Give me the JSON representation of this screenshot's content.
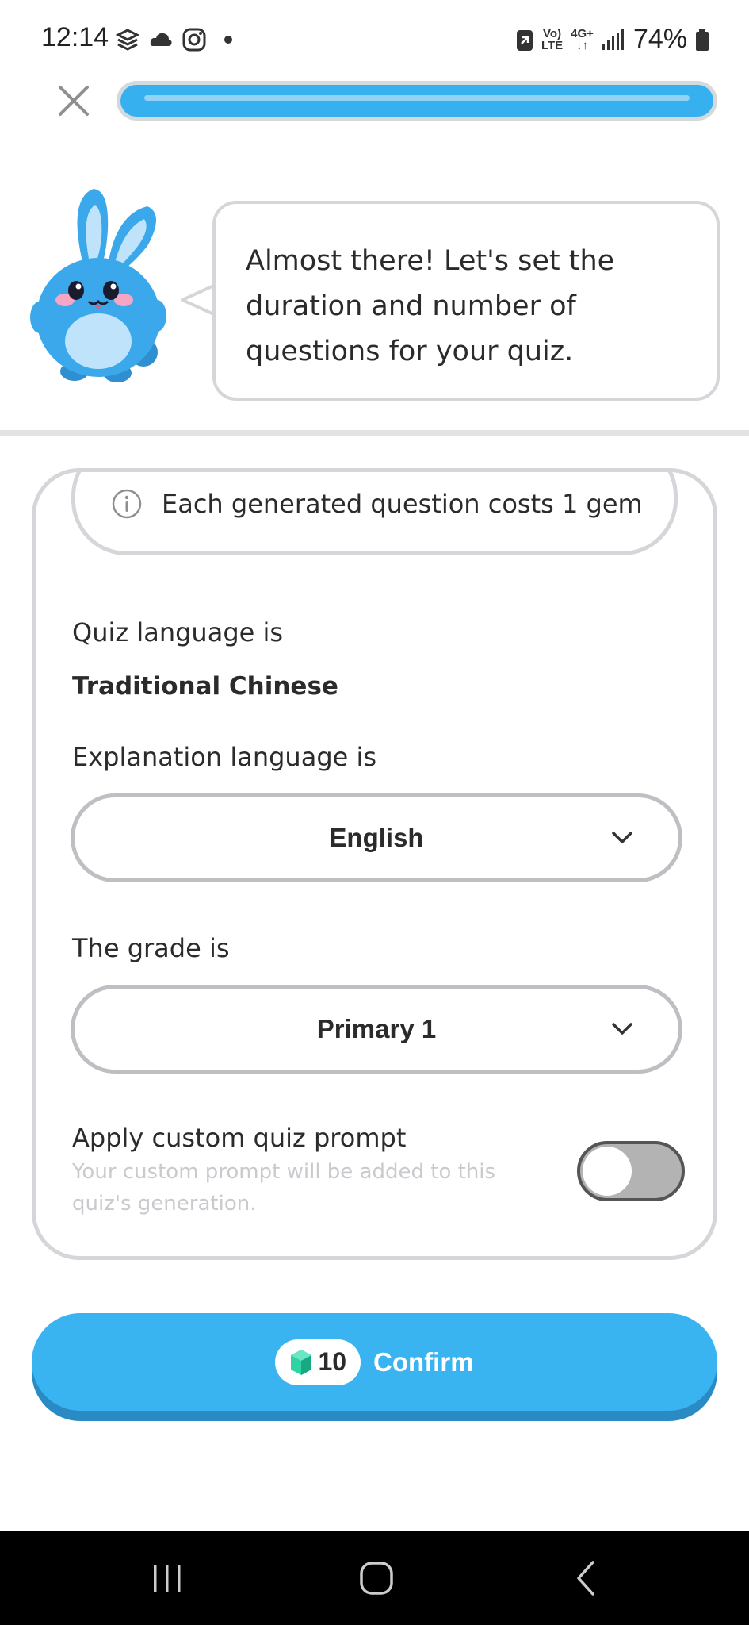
{
  "status_bar": {
    "time": "12:14",
    "network_top": "Vo)",
    "network_bottom": "LTE",
    "network2_top": "4G+",
    "network2_bottom": "↓↑",
    "battery": "74%"
  },
  "header": {
    "close_icon": "close-icon",
    "progress": 1.0,
    "accent_color": "#36b0ef"
  },
  "mascot": {
    "icon": "bunny-mascot"
  },
  "speech_bubble": {
    "text": "Almost there! Let's set the duration and number of questions for your quiz."
  },
  "card": {
    "info_text": "Each generated question costs 1 gem",
    "quiz_language_label": "Quiz language is",
    "quiz_language_value": "Traditional Chinese",
    "explanation_language_label": "Explanation language is",
    "explanation_language_value": "English",
    "grade_label": "The grade is",
    "grade_value": "Primary 1",
    "custom_prompt_title": "Apply custom quiz prompt",
    "custom_prompt_subtitle": "Your custom prompt will be added to this quiz's generation.",
    "custom_prompt_enabled": false
  },
  "confirm": {
    "gem_count": "10",
    "label": "Confirm",
    "color": "#3ab3f1"
  },
  "nav_bar": {
    "recents_icon": "recents-icon",
    "home_icon": "home-icon",
    "back_icon": "back-icon"
  }
}
